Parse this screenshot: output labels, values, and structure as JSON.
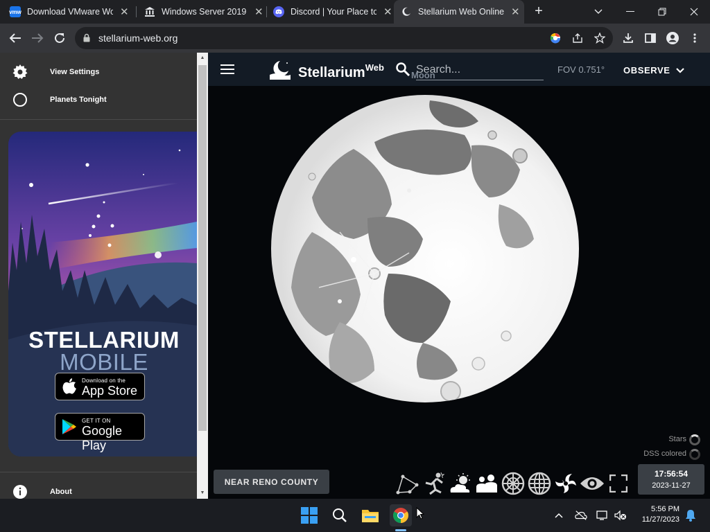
{
  "browser": {
    "tabs": [
      {
        "title": "Download VMware Wo",
        "favicon": "vmw"
      },
      {
        "title": "Windows Server 2019 (",
        "favicon": "museum-icon"
      },
      {
        "title": "Discord | Your Place to",
        "favicon": "discord-icon"
      },
      {
        "title": "Stellarium Web Online",
        "favicon": "stellarium-icon"
      }
    ],
    "active_tab": 3,
    "url": "stellarium-web.org"
  },
  "sidebar": {
    "items": [
      {
        "label": "View Settings",
        "icon": "gear-icon"
      },
      {
        "label": "Planets Tonight",
        "icon": "circle-icon"
      }
    ],
    "promo": {
      "title": "STELLARIUM",
      "subtitle": "MOBILE",
      "appstore_small": "Download on the",
      "appstore_big": "App Store",
      "googleplay_small": "GET IT ON",
      "googleplay_big": "Google Play"
    },
    "about_label": "About"
  },
  "stellarium": {
    "brand": "Stellarium",
    "brand_sup": "Web",
    "search_placeholder": "Search...",
    "selected_object": "Moon",
    "fov": "FOV 0.751°",
    "observe_label": "OBSERVE",
    "location": "NEAR RENO COUNTY",
    "layers": [
      {
        "label": "Stars"
      },
      {
        "label": "DSS colored"
      }
    ],
    "time": "17:56:54",
    "date": "2023-11-27",
    "accent": "#ffffff"
  },
  "taskbar": {
    "time": "5:56 PM",
    "date": "11/27/2023"
  }
}
